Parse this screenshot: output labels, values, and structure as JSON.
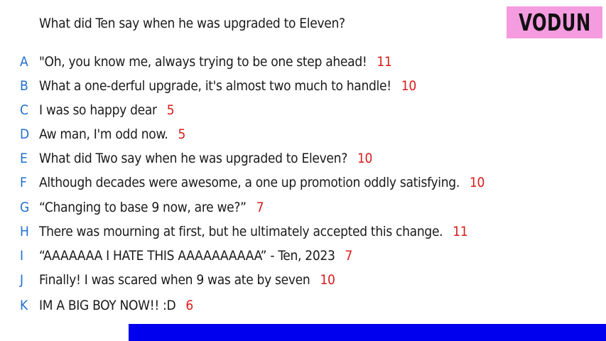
{
  "question": "What did Ten say when he was upgraded to Eleven?",
  "logo": "VODUN",
  "answers": [
    {
      "letter": "A",
      "text": "\"Oh, you know me, always trying to be one step ahead!",
      "score": "11"
    },
    {
      "letter": "B",
      "text": "What a one-derful upgrade, it's almost two much to handle!",
      "score": "10"
    },
    {
      "letter": "C",
      "text": "I was so happy dear",
      "score": "5"
    },
    {
      "letter": "D",
      "text": "Aw man, I'm odd now.",
      "score": "5"
    },
    {
      "letter": "E",
      "text": "What did Two say when he was upgraded to Eleven?",
      "score": "10"
    },
    {
      "letter": "F",
      "text": "Although decades were awesome, a one up promotion oddly satisfying.",
      "score": "10"
    },
    {
      "letter": "G",
      "text": "“Changing to base 9 now, are we?”",
      "score": "7"
    },
    {
      "letter": "H",
      "text": "There was mourning at first, but he ultimately accepted this change.",
      "score": "11"
    },
    {
      "letter": "I",
      "text": "“AAAAAAA I HATE THIS AAAAAAAAAA”  - Ten, 2023",
      "score": "7"
    },
    {
      "letter": "J",
      "text": "Finally! I was scared when 9 was ate by seven",
      "score": "10"
    },
    {
      "letter": "K",
      "text": "IM A BIG BOY NOW!! :D",
      "score": "6"
    }
  ],
  "colors": {
    "letter": "#1f6fd1",
    "score": "#d81b1b",
    "logo_bg": "#f59be0",
    "bar": "#0000ee"
  }
}
